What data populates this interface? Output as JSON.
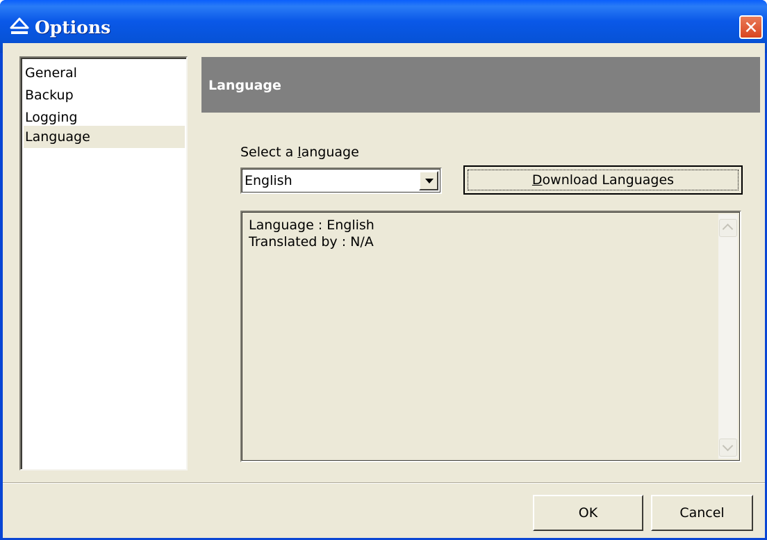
{
  "window": {
    "title": "Options",
    "icon": "eject-icon",
    "close_icon": "close-icon",
    "close_glyph": "✕"
  },
  "sidebar": {
    "items": [
      {
        "label": "General",
        "selected": false
      },
      {
        "label": "Backup",
        "selected": false
      },
      {
        "label": "Logging",
        "selected": false
      },
      {
        "label": "Language",
        "selected": true
      }
    ]
  },
  "main": {
    "header": "Language",
    "select_label": "Select a language",
    "select_value": "English",
    "download_button": "Download Languages",
    "info": {
      "line1": "Language : English",
      "line2": "Translated by : N/A"
    }
  },
  "footer": {
    "ok_label": "OK",
    "cancel_label": "Cancel"
  },
  "colors": {
    "titlebar": "#0a58e8",
    "dialog_bg": "#ece9d8",
    "header_band": "#808080",
    "close_button": "#d94520"
  }
}
